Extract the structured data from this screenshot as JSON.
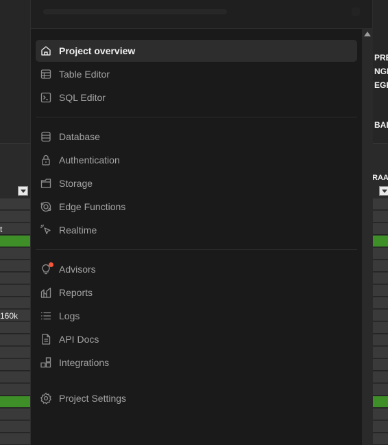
{
  "background": {
    "right_labels": [
      "PRE",
      "NGF",
      "EGF",
      "BAL",
      "RAA"
    ],
    "left_labels": [
      "t",
      "160k"
    ]
  },
  "menu": {
    "items": [
      {
        "label": "Project overview",
        "icon": "home-icon",
        "active": true
      },
      {
        "label": "Table Editor",
        "icon": "table-icon"
      },
      {
        "label": "SQL Editor",
        "icon": "terminal-icon"
      },
      {
        "label": "Database",
        "icon": "database-icon"
      },
      {
        "label": "Authentication",
        "icon": "lock-icon"
      },
      {
        "label": "Storage",
        "icon": "archive-icon"
      },
      {
        "label": "Edge Functions",
        "icon": "edge-functions-icon"
      },
      {
        "label": "Realtime",
        "icon": "cursor-click-icon"
      },
      {
        "label": "Advisors",
        "icon": "lightbulb-icon",
        "badge_color": "#f5563b"
      },
      {
        "label": "Reports",
        "icon": "chart-icon"
      },
      {
        "label": "Logs",
        "icon": "list-icon"
      },
      {
        "label": "API Docs",
        "icon": "file-text-icon"
      },
      {
        "label": "Integrations",
        "icon": "blocks-icon"
      },
      {
        "label": "Project Settings",
        "icon": "gear-icon"
      }
    ]
  },
  "colors": {
    "accent_green": "#3e8f27",
    "badge_red": "#f5563b",
    "panel_bg": "#1a1a1a",
    "active_bg": "#2d2d2d"
  }
}
